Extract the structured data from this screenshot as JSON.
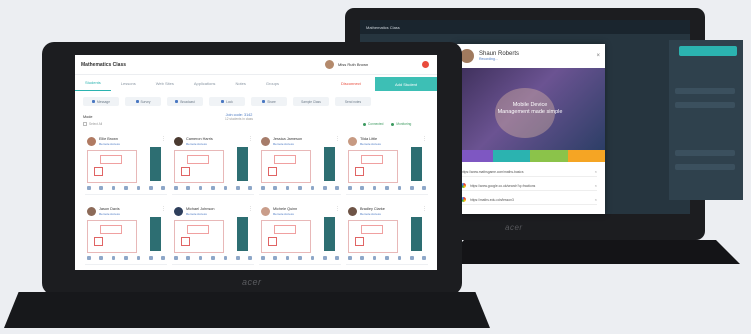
{
  "back_laptop": {
    "brand": "acer",
    "topbar_title": "Mathematics Class",
    "popup": {
      "name": "Shaun Roberts",
      "sub": "Recording...",
      "banner_title_line1": "Mobile Device",
      "banner_title_line2": "Management made simple",
      "tile_colors": [
        "#7e57c2",
        "#2bb3b0",
        "#8bc34a",
        "#f5a524"
      ],
      "links": [
        "https://www.mathsgame.com/maths-basics",
        "https://www.google.co.uk/search?q=fractions",
        "https://maths.edu.cdn/lesson3"
      ]
    }
  },
  "front_laptop": {
    "brand": "acer",
    "app": {
      "class_title": "Mathematics Class",
      "teacher_name": "Miss Ruth Brown",
      "tabs": [
        "Students",
        "Lessons",
        "Web Sites",
        "Applications",
        "Notes",
        "Groups"
      ],
      "active_tab": 0,
      "warning_label": "Disconnect",
      "add_button": "Add Student",
      "toolbar": [
        "Message",
        "Survey",
        "Broadcast",
        "Lock",
        "Share",
        "Sample Class",
        "Send notes"
      ],
      "filter_label": "Mode",
      "filter_check": "Select All",
      "center_info_a": "Join code: 3142",
      "center_info_b": "12 students in class",
      "legend": [
        "Connected",
        "Monitoring"
      ],
      "accent": "#2bb3b0",
      "cards": [
        {
          "name": "Ellie Brown",
          "status": "Remote Access",
          "avatar": "#b07a62"
        },
        {
          "name": "Cameron Harris",
          "status": "Remote Access",
          "avatar": "#4a3a30"
        },
        {
          "name": "Jessica Jameson",
          "status": "Remote Access",
          "avatar": "#a67c6a"
        },
        {
          "name": "Tilda Little",
          "status": "Remote Access",
          "avatar": "#c79a82"
        },
        {
          "name": "Jason Davis",
          "status": "Remote Access",
          "avatar": "#8c6a58"
        },
        {
          "name": "Michael Johnson",
          "status": "Remote Access",
          "avatar": "#2e3f5c"
        },
        {
          "name": "Michele Quinn",
          "status": "Remote Access",
          "avatar": "#c99d8a"
        },
        {
          "name": "Bradley Clarke",
          "status": "Remote Access",
          "avatar": "#6e5446"
        }
      ]
    }
  }
}
